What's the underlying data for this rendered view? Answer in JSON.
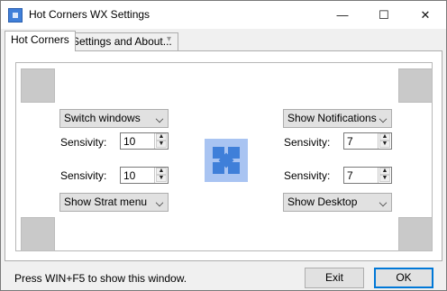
{
  "window": {
    "title": "Hot Corners WX Settings",
    "icon": "app-icon",
    "controls": {
      "minimize": "—",
      "maximize": "☐",
      "close": "✕"
    }
  },
  "tabs": [
    {
      "label": "Hot Corners",
      "active": true
    },
    {
      "label": "Settings and About...",
      "active": false
    }
  ],
  "tab_scroll_icon": "▾",
  "corners": {
    "top_left": {
      "action": "Switch windows",
      "sensitivity_label": "Sensivity:",
      "sensitivity": "10"
    },
    "top_right": {
      "action": "Show Notifications",
      "sensitivity_label": "Sensivity:",
      "sensitivity": "7"
    },
    "bottom_left": {
      "action": "Show Strat menu",
      "sensitivity_label": "Sensivity:",
      "sensitivity": "10"
    },
    "bottom_right": {
      "action": "Show Desktop",
      "sensitivity_label": "Sensivity:",
      "sensitivity": "7"
    }
  },
  "spin_up": "▲",
  "spin_down": "▼",
  "status_text": "Press WIN+F5 to show this window.",
  "buttons": {
    "exit": "Exit",
    "ok": "OK"
  },
  "colors": {
    "accent": "#3f7fd9",
    "accent_light": "#a9c4f2",
    "corner_preview": "#c9c9c9",
    "default_button_border": "#0078d7"
  }
}
